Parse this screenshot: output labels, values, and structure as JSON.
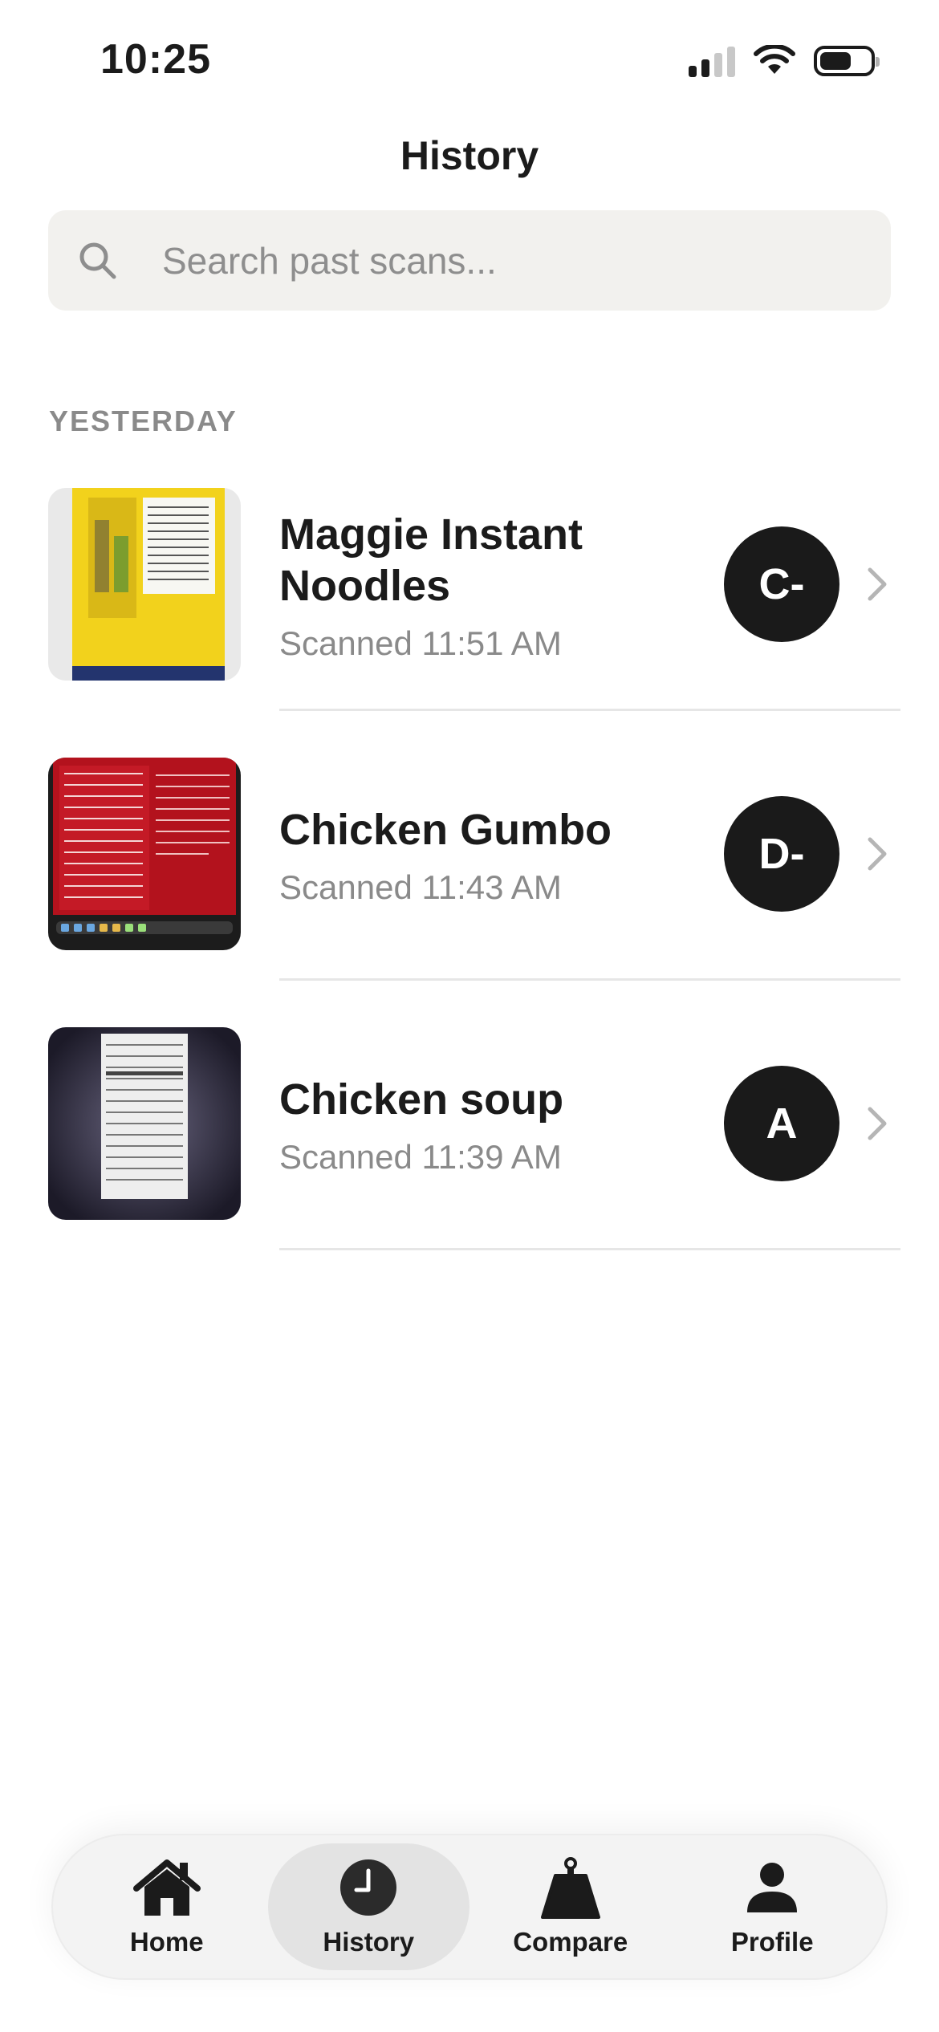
{
  "status_bar": {
    "time": "10:25"
  },
  "header": {
    "title": "History"
  },
  "search": {
    "placeholder": "Search past scans..."
  },
  "sections": [
    {
      "label": "YESTERDAY",
      "items": [
        {
          "title": "Maggie Instant Noodles",
          "subtitle": "Scanned 11:51 AM",
          "grade": "C-"
        },
        {
          "title": "Chicken Gumbo",
          "subtitle": "Scanned 11:43 AM",
          "grade": "D-"
        },
        {
          "title": "Chicken soup",
          "subtitle": "Scanned 11:39 AM",
          "grade": "A"
        }
      ]
    }
  ],
  "tab_bar": {
    "tabs": [
      {
        "label": "Home",
        "icon": "home-icon"
      },
      {
        "label": "History",
        "icon": "clock-icon",
        "active": true
      },
      {
        "label": "Compare",
        "icon": "weight-icon"
      },
      {
        "label": "Profile",
        "icon": "person-icon"
      }
    ]
  },
  "colors": {
    "text": "#1b1b1b",
    "secondary_text": "#8a8a8a",
    "search_bg": "#f2f1ee",
    "grade_bg": "#1a1a1a",
    "tab_bar_bg": "#f3f3f3",
    "active_tab_bg": "#e3e3e3"
  }
}
